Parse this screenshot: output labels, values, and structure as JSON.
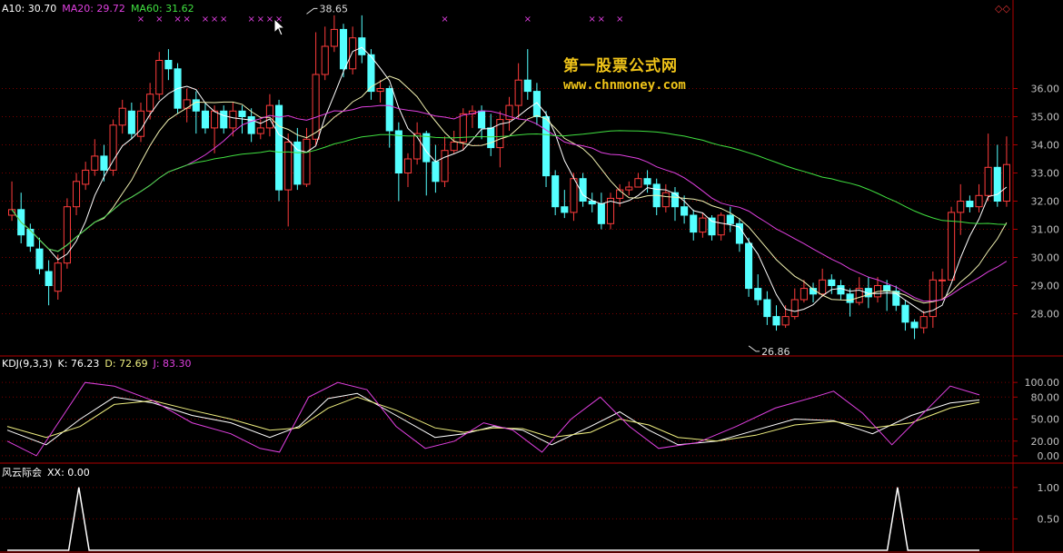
{
  "chart_data": [
    {
      "type": "candlestick",
      "name": "price",
      "legend": [
        {
          "text": "A10: 30.70",
          "color": "#ffffff"
        },
        {
          "text": "MA20: 29.72",
          "color": "#e040e0"
        },
        {
          "text": "MA60: 31.62",
          "color": "#40e040"
        }
      ],
      "ylim": [
        26.5,
        38.5
      ],
      "yticks": [
        28.0,
        29.0,
        30.0,
        31.0,
        32.0,
        33.0,
        34.0,
        35.0,
        36.0
      ],
      "annotations": [
        {
          "text": "38.65",
          "index": 32,
          "value": 38.65,
          "pos": "high"
        },
        {
          "text": "26.86",
          "index": 80,
          "value": 26.86,
          "pos": "low"
        }
      ],
      "marker_indices": [
        14,
        16,
        18,
        19,
        21,
        22,
        23,
        26,
        27,
        28,
        29,
        47,
        56,
        63,
        64,
        66
      ],
      "marker_symbol": "×",
      "candles": [
        [
          31.5,
          31.7,
          32.7,
          31.3
        ],
        [
          31.7,
          30.8,
          32.3,
          30.5
        ],
        [
          31.0,
          30.4,
          31.2,
          30.2
        ],
        [
          30.3,
          29.6,
          30.7,
          29.4
        ],
        [
          29.5,
          29.0,
          29.9,
          28.3
        ],
        [
          28.8,
          29.8,
          30.1,
          28.5
        ],
        [
          29.8,
          31.8,
          32.1,
          29.6
        ],
        [
          31.8,
          32.7,
          33.0,
          31.5
        ],
        [
          32.6,
          33.1,
          33.4,
          32.4
        ],
        [
          33.1,
          33.6,
          34.2,
          32.9
        ],
        [
          33.6,
          33.1,
          34.0,
          32.7
        ],
        [
          33.1,
          34.7,
          34.9,
          32.9
        ],
        [
          34.7,
          35.3,
          35.6,
          34.4
        ],
        [
          35.2,
          34.4,
          35.5,
          34.2
        ],
        [
          34.3,
          35.2,
          35.5,
          34.1
        ],
        [
          35.2,
          35.8,
          36.2,
          34.9
        ],
        [
          35.8,
          37.0,
          37.3,
          35.6
        ],
        [
          37.0,
          36.7,
          37.4,
          36.3
        ],
        [
          36.7,
          35.3,
          36.9,
          35.1
        ],
        [
          35.3,
          35.6,
          36.0,
          34.8
        ],
        [
          35.6,
          35.2,
          35.9,
          34.4
        ],
        [
          35.2,
          34.6,
          35.5,
          34.4
        ],
        [
          34.6,
          35.2,
          35.4,
          33.7
        ],
        [
          35.2,
          34.6,
          35.4,
          34.4
        ],
        [
          34.6,
          35.2,
          35.5,
          34.3
        ],
        [
          35.2,
          35.0,
          35.4,
          34.4
        ],
        [
          35.0,
          34.4,
          35.3,
          34.1
        ],
        [
          34.4,
          34.6,
          34.9,
          34.2
        ],
        [
          34.6,
          35.4,
          35.8,
          34.3
        ],
        [
          35.4,
          32.4,
          35.6,
          32.0
        ],
        [
          32.4,
          34.1,
          34.4,
          31.1
        ],
        [
          34.1,
          32.6,
          34.6,
          32.4
        ],
        [
          32.6,
          34.2,
          34.6,
          32.5
        ],
        [
          34.2,
          36.5,
          38.0,
          34.0
        ],
        [
          36.5,
          37.5,
          38.2,
          36.3
        ],
        [
          37.5,
          38.1,
          38.6,
          37.3
        ],
        [
          38.1,
          36.7,
          38.3,
          36.4
        ],
        [
          36.7,
          37.8,
          38.2,
          36.5
        ],
        [
          37.8,
          37.2,
          38.6,
          36.9
        ],
        [
          37.2,
          35.9,
          37.4,
          35.6
        ],
        [
          35.9,
          36.0,
          36.3,
          35.5
        ],
        [
          36.0,
          34.5,
          36.1,
          33.9
        ],
        [
          34.5,
          33.0,
          34.8,
          32.0
        ],
        [
          33.0,
          33.5,
          33.7,
          32.5
        ],
        [
          33.5,
          34.4,
          34.8,
          33.3
        ],
        [
          34.4,
          33.4,
          34.5,
          32.2
        ],
        [
          33.4,
          32.7,
          34.0,
          32.3
        ],
        [
          32.7,
          33.8,
          34.3,
          32.5
        ],
        [
          33.8,
          34.1,
          34.5,
          33.7
        ],
        [
          34.1,
          35.1,
          35.3,
          33.8
        ],
        [
          35.1,
          35.2,
          35.4,
          34.6
        ],
        [
          35.2,
          34.6,
          35.4,
          34.2
        ],
        [
          34.6,
          33.9,
          35.1,
          33.6
        ],
        [
          33.9,
          34.9,
          35.2,
          33.2
        ],
        [
          34.9,
          35.4,
          35.7,
          34.5
        ],
        [
          35.4,
          36.3,
          36.9,
          34.9
        ],
        [
          36.3,
          35.9,
          37.4,
          35.6
        ],
        [
          35.9,
          35.0,
          36.2,
          34.7
        ],
        [
          35.0,
          32.9,
          35.2,
          32.5
        ],
        [
          32.9,
          31.8,
          33.1,
          31.5
        ],
        [
          31.8,
          31.6,
          32.4,
          31.4
        ],
        [
          31.6,
          32.8,
          33.0,
          31.3
        ],
        [
          32.8,
          32.0,
          33.0,
          31.8
        ],
        [
          32.0,
          31.9,
          32.3,
          31.6
        ],
        [
          31.9,
          31.2,
          32.3,
          31.0
        ],
        [
          31.2,
          32.1,
          32.3,
          31.0
        ],
        [
          32.1,
          32.4,
          32.6,
          31.8
        ],
        [
          32.4,
          32.5,
          32.7,
          32.2
        ],
        [
          32.5,
          32.8,
          33.0,
          32.5
        ],
        [
          32.8,
          32.6,
          33.1,
          32.3
        ],
        [
          32.6,
          31.8,
          32.8,
          31.5
        ],
        [
          31.8,
          32.3,
          32.6,
          31.6
        ],
        [
          32.3,
          31.8,
          32.5,
          31.3
        ],
        [
          31.8,
          31.5,
          32.2,
          31.2
        ],
        [
          31.5,
          30.9,
          31.7,
          30.6
        ],
        [
          30.9,
          31.4,
          31.6,
          30.7
        ],
        [
          31.4,
          30.8,
          31.5,
          30.6
        ],
        [
          30.8,
          31.5,
          31.6,
          30.6
        ],
        [
          31.5,
          31.2,
          31.8,
          30.9
        ],
        [
          31.2,
          30.5,
          31.4,
          30.2
        ],
        [
          30.5,
          28.9,
          30.7,
          28.6
        ],
        [
          28.9,
          28.5,
          29.4,
          28.3
        ],
        [
          28.5,
          27.9,
          28.8,
          27.6
        ],
        [
          27.9,
          27.6,
          28.3,
          27.4
        ],
        [
          27.6,
          27.9,
          28.3,
          27.5
        ],
        [
          27.9,
          28.5,
          28.9,
          27.8
        ],
        [
          28.5,
          28.9,
          29.2,
          28.4
        ],
        [
          28.9,
          28.7,
          29.1,
          28.4
        ],
        [
          28.7,
          29.2,
          29.6,
          28.6
        ],
        [
          29.2,
          29.0,
          29.4,
          28.7
        ],
        [
          29.0,
          28.7,
          29.2,
          28.5
        ],
        [
          28.7,
          28.4,
          28.9,
          27.9
        ],
        [
          28.4,
          28.9,
          29.3,
          28.3
        ],
        [
          28.9,
          28.6,
          29.3,
          28.2
        ],
        [
          28.6,
          29.0,
          29.3,
          28.4
        ],
        [
          29.0,
          28.8,
          29.2,
          28.1
        ],
        [
          28.8,
          28.3,
          29.0,
          28.1
        ],
        [
          28.3,
          27.7,
          28.5,
          27.4
        ],
        [
          27.7,
          27.5,
          27.8,
          27.1
        ],
        [
          27.5,
          27.9,
          28.1,
          27.3
        ],
        [
          27.9,
          29.2,
          29.5,
          27.5
        ],
        [
          29.2,
          29.2,
          29.6,
          28.5
        ],
        [
          29.2,
          31.6,
          31.8,
          29.3
        ],
        [
          31.6,
          32.0,
          32.6,
          30.8
        ],
        [
          32.0,
          31.8,
          32.2,
          31.6
        ],
        [
          31.8,
          32.2,
          32.6,
          31.6
        ],
        [
          32.2,
          33.2,
          34.4,
          32.0
        ],
        [
          33.2,
          32.0,
          34.0,
          31.8
        ],
        [
          32.0,
          33.3,
          34.3,
          31.8
        ]
      ]
    },
    {
      "type": "line",
      "name": "kdj",
      "legend": [
        {
          "text": "KDJ(9,3,3)",
          "color": "#ffffff"
        },
        {
          "text": "K: 76.23",
          "color": "#ffffff"
        },
        {
          "text": "D: 72.69",
          "color": "#f0f080"
        },
        {
          "text": "J: 83.30",
          "color": "#e040e0"
        }
      ],
      "ylim": [
        -10,
        120
      ],
      "yticks": [
        0.0,
        20.0,
        50.0,
        80.0,
        100.0
      ],
      "series": [
        {
          "name": "K",
          "color": "#ffffff",
          "points": [
            [
              0,
              35
            ],
            [
              8,
              15
            ],
            [
              15,
              50
            ],
            [
              22,
              80
            ],
            [
              30,
              72
            ],
            [
              38,
              55
            ],
            [
              46,
              45
            ],
            [
              54,
              25
            ],
            [
              60,
              40
            ],
            [
              66,
              78
            ],
            [
              72,
              85
            ],
            [
              80,
              55
            ],
            [
              88,
              25
            ],
            [
              94,
              30
            ],
            [
              100,
              40
            ],
            [
              106,
              35
            ],
            [
              112,
              15
            ],
            [
              120,
              40
            ],
            [
              126,
              60
            ],
            [
              132,
              35
            ],
            [
              138,
              15
            ],
            [
              146,
              20
            ],
            [
              154,
              35
            ],
            [
              162,
              50
            ],
            [
              170,
              48
            ],
            [
              178,
              30
            ],
            [
              186,
              55
            ],
            [
              194,
              72
            ],
            [
              200,
              76
            ]
          ]
        },
        {
          "name": "D",
          "color": "#f0f080",
          "points": [
            [
              0,
              40
            ],
            [
              8,
              25
            ],
            [
              15,
              40
            ],
            [
              22,
              70
            ],
            [
              30,
              75
            ],
            [
              38,
              62
            ],
            [
              46,
              50
            ],
            [
              54,
              35
            ],
            [
              60,
              38
            ],
            [
              66,
              65
            ],
            [
              72,
              80
            ],
            [
              80,
              62
            ],
            [
              88,
              38
            ],
            [
              94,
              32
            ],
            [
              100,
              38
            ],
            [
              106,
              37
            ],
            [
              112,
              25
            ],
            [
              120,
              32
            ],
            [
              126,
              50
            ],
            [
              132,
              42
            ],
            [
              138,
              25
            ],
            [
              146,
              20
            ],
            [
              154,
              28
            ],
            [
              162,
              42
            ],
            [
              170,
              47
            ],
            [
              178,
              38
            ],
            [
              186,
              45
            ],
            [
              194,
              65
            ],
            [
              200,
              73
            ]
          ]
        },
        {
          "name": "J",
          "color": "#e040e0",
          "points": [
            [
              0,
              20
            ],
            [
              6,
              0
            ],
            [
              12,
              60
            ],
            [
              16,
              100
            ],
            [
              22,
              95
            ],
            [
              30,
              75
            ],
            [
              38,
              45
            ],
            [
              46,
              30
            ],
            [
              52,
              10
            ],
            [
              56,
              5
            ],
            [
              62,
              80
            ],
            [
              68,
              100
            ],
            [
              74,
              90
            ],
            [
              80,
              40
            ],
            [
              86,
              10
            ],
            [
              92,
              20
            ],
            [
              98,
              45
            ],
            [
              104,
              35
            ],
            [
              110,
              5
            ],
            [
              116,
              50
            ],
            [
              122,
              80
            ],
            [
              128,
              40
            ],
            [
              134,
              10
            ],
            [
              142,
              18
            ],
            [
              150,
              40
            ],
            [
              158,
              65
            ],
            [
              166,
              80
            ],
            [
              170,
              88
            ],
            [
              176,
              58
            ],
            [
              182,
              15
            ],
            [
              188,
              55
            ],
            [
              194,
              95
            ],
            [
              200,
              83
            ]
          ]
        }
      ]
    },
    {
      "type": "line",
      "name": "xx",
      "legend": [
        {
          "text": "风云际会",
          "color": "#ffffff"
        },
        {
          "text": "XX: 0.00",
          "color": "#ffffff"
        }
      ],
      "ylim": [
        0,
        1.2
      ],
      "yticks": [
        0.5,
        1.0
      ],
      "series": [
        {
          "name": "XX",
          "color": "#ffffff",
          "points": [
            [
              0,
              0
            ],
            [
              6,
              0
            ],
            [
              7,
              1
            ],
            [
              8,
              0
            ],
            [
              86,
              0
            ],
            [
              87,
              1
            ],
            [
              88,
              0
            ],
            [
              95,
              0
            ]
          ]
        }
      ]
    }
  ]
}
